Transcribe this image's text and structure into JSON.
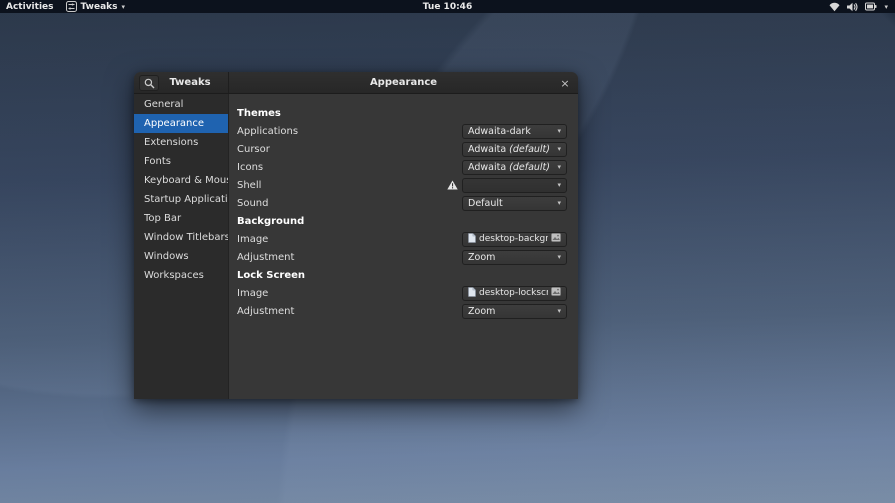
{
  "topbar": {
    "activities_label": "Activities",
    "app_menu_label": "Tweaks",
    "clock": "Tue 10:46"
  },
  "window": {
    "header": {
      "sidebar_title": "Tweaks",
      "title": "Appearance"
    },
    "sidebar": {
      "items": [
        {
          "label": "General"
        },
        {
          "label": "Appearance"
        },
        {
          "label": "Extensions"
        },
        {
          "label": "Fonts"
        },
        {
          "label": "Keyboard & Mouse"
        },
        {
          "label": "Startup Applications"
        },
        {
          "label": "Top Bar"
        },
        {
          "label": "Window Titlebars"
        },
        {
          "label": "Windows"
        },
        {
          "label": "Workspaces"
        }
      ]
    },
    "sections": [
      {
        "title": "Themes",
        "rows": [
          {
            "label": "Applications",
            "value": "Adwaita-dark"
          },
          {
            "label": "Cursor",
            "value": "Adwaita",
            "note": "(default)"
          },
          {
            "label": "Icons",
            "value": "Adwaita",
            "note": "(default)"
          },
          {
            "label": "Shell",
            "value": ""
          },
          {
            "label": "Sound",
            "value": "Default"
          }
        ]
      },
      {
        "title": "Background",
        "rows": [
          {
            "label": "Image",
            "file": "desktop-background.xml"
          },
          {
            "label": "Adjustment",
            "value": "Zoom"
          }
        ]
      },
      {
        "title": "Lock Screen",
        "rows": [
          {
            "label": "Image",
            "file": "desktop-lockscreen.xml"
          },
          {
            "label": "Adjustment",
            "value": "Zoom"
          }
        ]
      }
    ]
  },
  "colors": {
    "accent": "#1f63b0",
    "topbar_bg": "#0c121d",
    "titlebar_bg": "#2a2a2a",
    "sidebar_bg": "#2b2b2b",
    "content_bg": "#373737"
  }
}
